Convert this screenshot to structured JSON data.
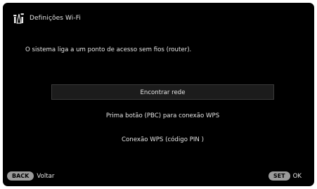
{
  "header": {
    "title": "Definições Wi-Fi",
    "icon": "wifi-settings-icon"
  },
  "description": "O sistema liga a um ponto de acesso sem fios (router).",
  "menu": {
    "items": [
      {
        "label": "Encontrar rede",
        "selected": true
      },
      {
        "label": "Prima botão (PBC) para conexão WPS",
        "selected": false
      },
      {
        "label": "Conexão WPS (código PIN )",
        "selected": false
      }
    ]
  },
  "footer": {
    "back_key": "BACK",
    "back_label": "Voltar",
    "set_key": "SET",
    "set_label": "OK"
  },
  "colors": {
    "background": "#000000",
    "text": "#e6e6e6",
    "key_pill": "#9a9a9a",
    "selected_row": "#1c1c1c"
  }
}
